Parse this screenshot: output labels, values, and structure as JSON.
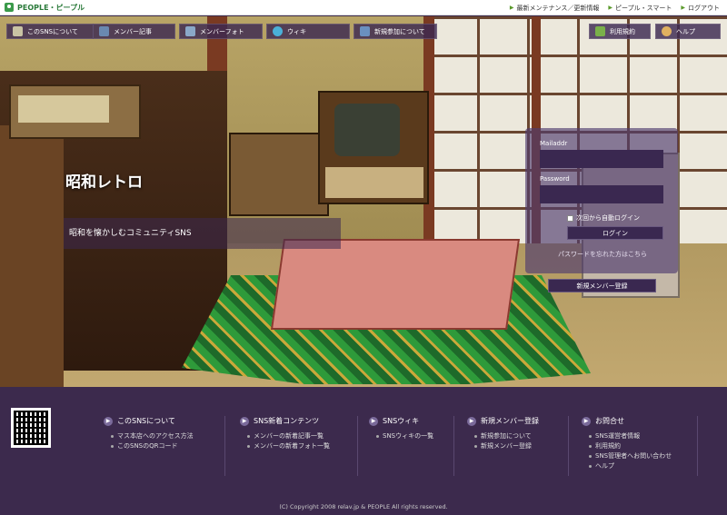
{
  "header": {
    "logo_text": "PEOPLE・ピープル",
    "links": [
      "最新メンテナンス／更新情報",
      "ピープル・スマート",
      "ログアウト"
    ]
  },
  "nav": {
    "items": [
      {
        "label": "このSNSについて",
        "icon": "phone-icon",
        "color": "#c9c3a4"
      },
      {
        "label": "メンバー記事",
        "icon": "document-icon",
        "color": "#6a88b0"
      },
      {
        "label": "メンバーフォト",
        "icon": "photo-icon",
        "color": "#8aa8c8"
      },
      {
        "label": "ウィキ",
        "icon": "globe-icon",
        "color": "#4ab0d8"
      },
      {
        "label": "新規参加について",
        "icon": "people-icon",
        "color": "#6a90c0"
      },
      {
        "label": "利用規約",
        "icon": "checklist-icon",
        "color": "#7ab04a"
      },
      {
        "label": "ヘルプ",
        "icon": "help-icon",
        "color": "#e0b060"
      }
    ]
  },
  "hero": {
    "title": "昭和レトロ",
    "subtitle": "昭和を懐かしむコミュニティSNS"
  },
  "login": {
    "mail_label": "Mailaddr",
    "password_label": "Password",
    "remember_label": "次回から自動ログイン",
    "login_button": "ログイン",
    "forgot_link": "パスワードを忘れた方はこちら",
    "signup_button": "新規メンバー登録"
  },
  "footer": {
    "columns": [
      {
        "title": "このSNSについて",
        "items": [
          "マス本店へのアクセス方法",
          "このSNSのQRコード"
        ]
      },
      {
        "title": "SNS新着コンテンツ",
        "items": [
          "メンバーの新着記事一覧",
          "メンバーの新着フォト一覧"
        ]
      },
      {
        "title": "SNSウィキ",
        "items": [
          "SNSウィキの一覧"
        ]
      },
      {
        "title": "新規メンバー登録",
        "items": [
          "新規参加について",
          "新規メンバー登録"
        ]
      },
      {
        "title": "お問合せ",
        "items": [
          "SNS運営者情報",
          "利用規約",
          "SNS管理者へお問い合わせ",
          "ヘルプ"
        ]
      }
    ],
    "copyright": "(C) Copyright 2008 relav.jp & PEOPLE All rights reserved."
  }
}
